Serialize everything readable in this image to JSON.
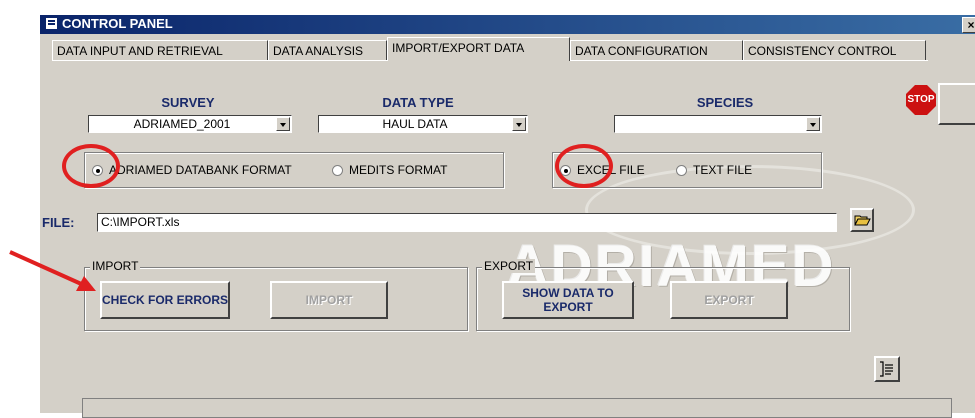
{
  "window": {
    "title": "CONTROL PANEL",
    "close_label": "×"
  },
  "tabs": [
    {
      "label": "DATA INPUT AND RETRIEVAL"
    },
    {
      "label": "DATA ANALYSIS"
    },
    {
      "label": "IMPORT/EXPORT DATA"
    },
    {
      "label": "DATA CONFIGURATION"
    },
    {
      "label": "CONSISTENCY CONTROL"
    }
  ],
  "filters": {
    "survey": {
      "label": "SURVEY",
      "value": "ADRIAMED_2001"
    },
    "data_type": {
      "label": "DATA TYPE",
      "value": "HAUL DATA"
    },
    "species": {
      "label": "SPECIES",
      "value": ""
    }
  },
  "format_options": [
    {
      "label": "ADRIAMED DATABANK FORMAT",
      "selected": true
    },
    {
      "label": "MEDITS FORMAT",
      "selected": false
    }
  ],
  "file_type_options": [
    {
      "label": "EXCEL FILE",
      "selected": true
    },
    {
      "label": "TEXT FILE",
      "selected": false
    }
  ],
  "file": {
    "label": "FILE:",
    "value": "C:\\IMPORT.xls"
  },
  "import_section": {
    "label": "IMPORT",
    "check_errors_label": "CHECK FOR ERRORS",
    "import_label": "IMPORT"
  },
  "export_section": {
    "label": "EXPORT",
    "show_data_label": "SHOW DATA TO EXPORT",
    "export_label": "EXPORT"
  },
  "stop_label": "STOP",
  "watermark": "ADRIAMED",
  "colors": {
    "title_bar": "#0a246a",
    "label_blue": "#1a2a6a",
    "annotation_red": "#e02020",
    "stop_red": "#cc1111"
  },
  "icons": [
    "folder-open-icon",
    "report-icon",
    "stop-sign-icon"
  ]
}
